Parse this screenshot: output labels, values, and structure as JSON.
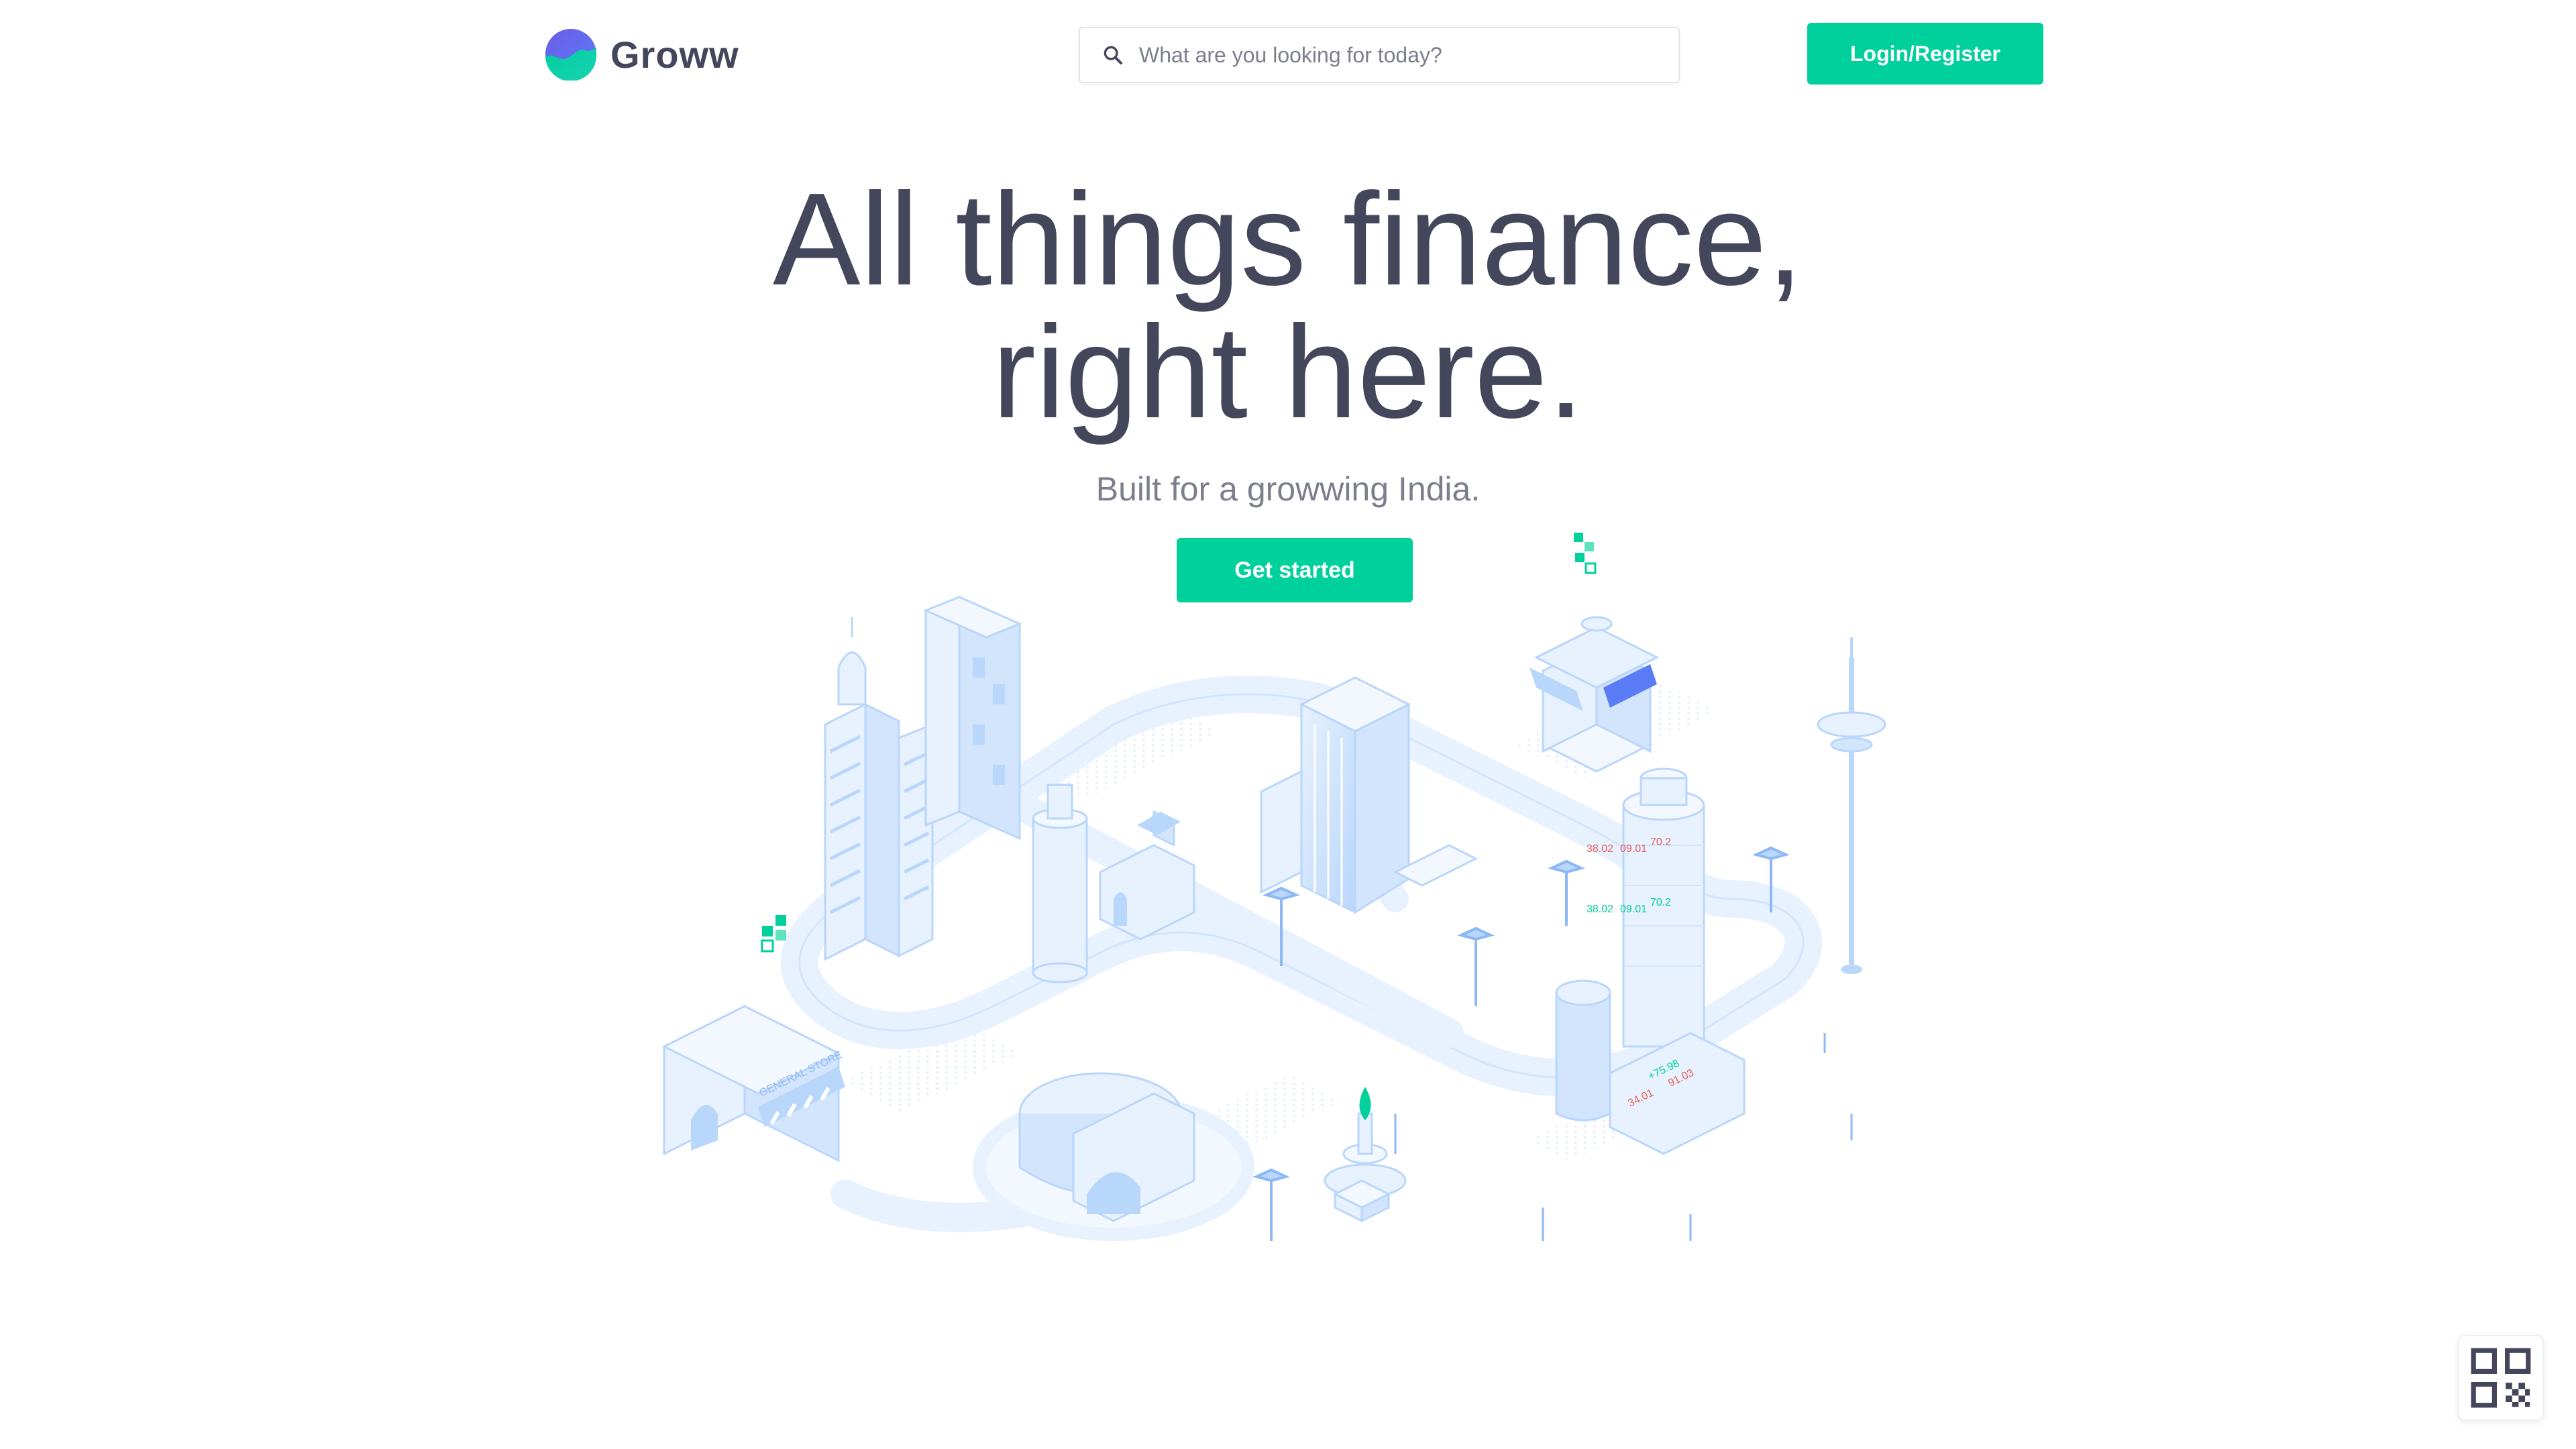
{
  "header": {
    "brand_name": "Groww",
    "search": {
      "placeholder": "What are you looking for today?",
      "value": ""
    },
    "login_label": "Login/Register"
  },
  "hero": {
    "title_line1": "All things finance,",
    "title_line2": "right here.",
    "subtitle": "Built for a growwing India.",
    "cta_label": "Get started"
  },
  "illustration": {
    "store_sign": "GENERAL STORE",
    "ticker_values": [
      "38.02",
      "09.01",
      "70.2",
      "34.01",
      "91.03",
      "+75.98"
    ]
  },
  "colors": {
    "accent": "#00d09c",
    "text_primary": "#44475b",
    "text_secondary": "#7c7e8c",
    "illustration_blue": "#b9d6fb",
    "illustration_light": "#e8f2fe"
  },
  "icons": {
    "search": "search-icon",
    "qr": "qr-code-icon",
    "logo": "groww-logo-icon"
  }
}
